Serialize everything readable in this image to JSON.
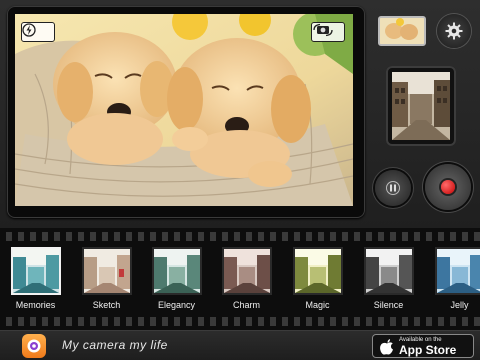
{
  "camera": {
    "overlay_icons": [
      "flash-icon",
      "camera-switch-icon"
    ],
    "controls": [
      "gallery-thumbnail",
      "gear-icon",
      "pause-icon",
      "record-icon"
    ],
    "record_color": "#d40000"
  },
  "filters": {
    "selected": "Memories",
    "items": [
      {
        "label": "Memories"
      },
      {
        "label": "Sketch"
      },
      {
        "label": "Elegancy"
      },
      {
        "label": "Charm"
      },
      {
        "label": "Magic"
      },
      {
        "label": "Silence"
      },
      {
        "label": "Jelly"
      }
    ]
  },
  "bottom_bar": {
    "tagline": "My camera my life",
    "badge_small": "Available on the",
    "badge_big": "App Store"
  }
}
